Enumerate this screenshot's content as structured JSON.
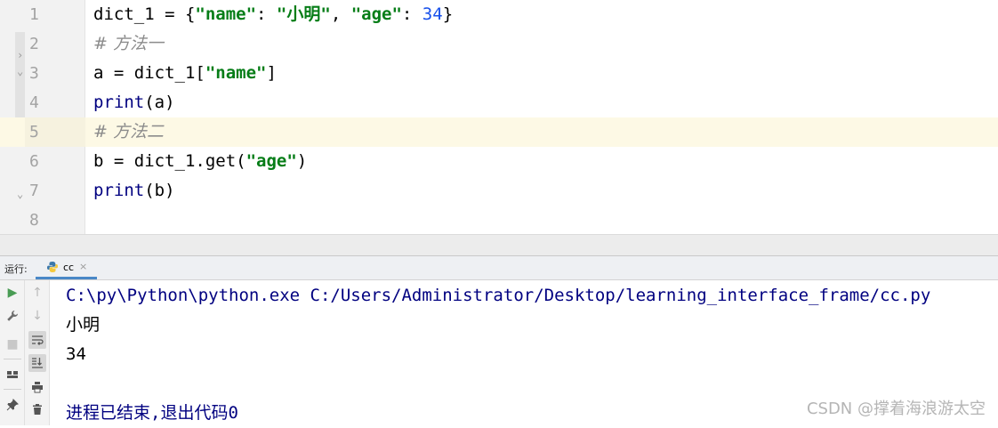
{
  "editor": {
    "lines": [
      {
        "num": "1",
        "tokens": [
          {
            "t": "dict_1 = {",
            "c": ""
          },
          {
            "t": "\"name\"",
            "c": "kw-str"
          },
          {
            "t": ": ",
            "c": ""
          },
          {
            "t": "\"小明\"",
            "c": "kw-str"
          },
          {
            "t": ", ",
            "c": ""
          },
          {
            "t": "\"age\"",
            "c": "kw-str"
          },
          {
            "t": ": ",
            "c": ""
          },
          {
            "t": "34",
            "c": "kw-num"
          },
          {
            "t": "}",
            "c": ""
          }
        ]
      },
      {
        "num": "2",
        "tokens": [
          {
            "t": "# 方法一",
            "c": "kw-cmt"
          }
        ]
      },
      {
        "num": "3",
        "tokens": [
          {
            "t": "a = dict_1[",
            "c": ""
          },
          {
            "t": "\"name\"",
            "c": "kw-str"
          },
          {
            "t": "]",
            "c": ""
          }
        ]
      },
      {
        "num": "4",
        "tokens": [
          {
            "t": "print",
            "c": "kw-fn"
          },
          {
            "t": "(a)",
            "c": ""
          }
        ]
      },
      {
        "num": "5",
        "tokens": [
          {
            "t": "# 方法二",
            "c": "kw-cmt"
          }
        ],
        "current": true
      },
      {
        "num": "6",
        "tokens": [
          {
            "t": "b = dict_1.get(",
            "c": ""
          },
          {
            "t": "\"age\"",
            "c": "kw-str"
          },
          {
            "t": ")",
            "c": ""
          }
        ]
      },
      {
        "num": "7",
        "tokens": [
          {
            "t": "print",
            "c": "kw-fn"
          },
          {
            "t": "(b)",
            "c": ""
          }
        ]
      },
      {
        "num": "8",
        "tokens": []
      }
    ]
  },
  "run_panel": {
    "label": "运行:",
    "tab_name": "cc",
    "tab_close": "×",
    "console": {
      "command": "C:\\py\\Python\\python.exe C:/Users/Administrator/Desktop/learning_interface_frame/cc.py",
      "output_1": "小明",
      "output_2": "34",
      "exit_message": "进程已结束,退出代码0"
    },
    "toolbar_left": [
      "run-icon",
      "wrench-icon",
      "stop-icon",
      "layout-icon",
      "pin-icon"
    ],
    "toolbar_right": [
      "up-arrow-icon",
      "down-arrow-icon",
      "soft-wrap-icon",
      "scroll-to-end-icon",
      "print-icon",
      "trash-icon"
    ]
  },
  "watermark": "CSDN @撑着海浪游太空",
  "colors": {
    "string": "#067d17",
    "number": "#1750eb",
    "builtin": "#000080",
    "comment": "#8c8c8c",
    "current_line": "#fdf9e5",
    "tab_underline": "#4a88c7",
    "run_green": "#499c54"
  }
}
